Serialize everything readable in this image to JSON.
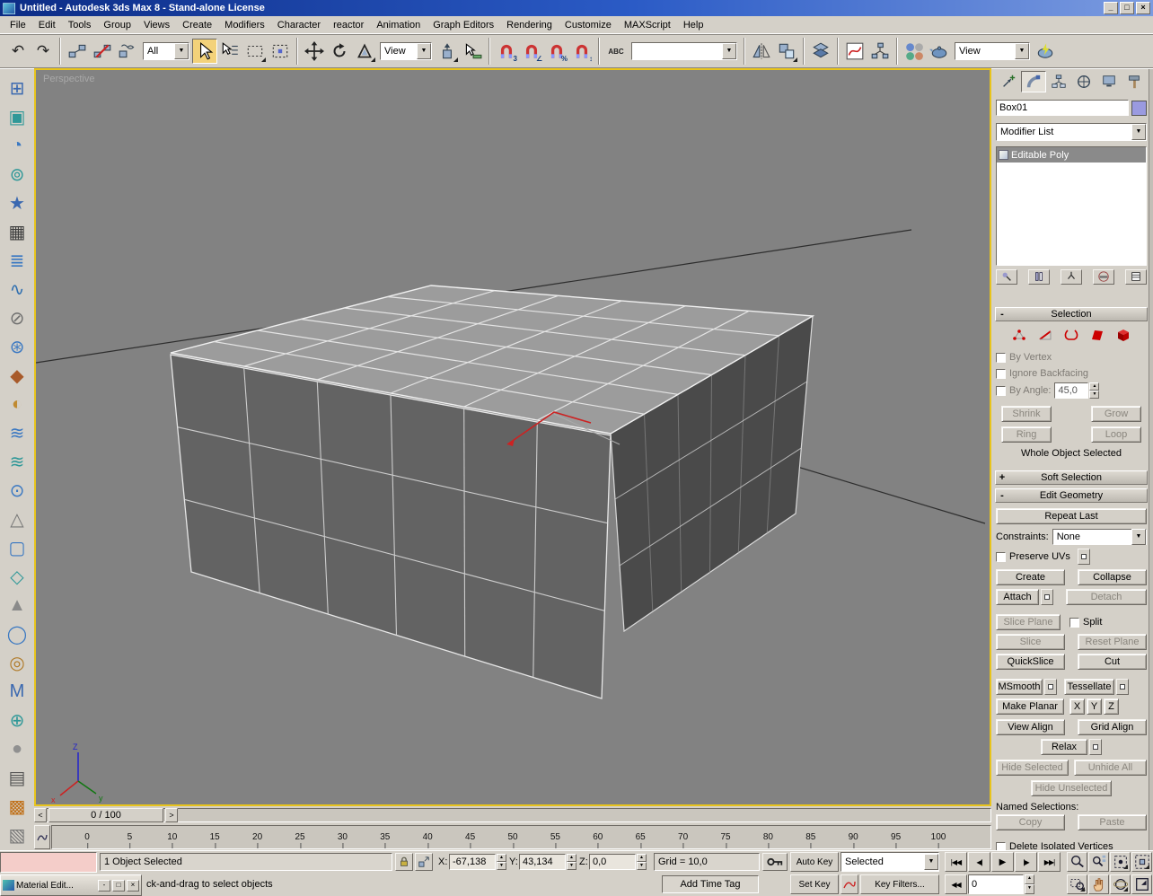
{
  "window": {
    "title": "Untitled - Autodesk 3ds Max 8 - Stand-alone License"
  },
  "menu": {
    "items": [
      "File",
      "Edit",
      "Tools",
      "Group",
      "Views",
      "Create",
      "Modifiers",
      "Character",
      "reactor",
      "Animation",
      "Graph Editors",
      "Rendering",
      "Customize",
      "MAXScript",
      "Help"
    ]
  },
  "toolbar": {
    "filter_value": "All",
    "coord_value": "View",
    "named_sets_value": "",
    "render_type_value": "View"
  },
  "left_toolbar": {
    "icons": [
      {
        "name": "left-tool-box-icon",
        "glyph": "⊞",
        "color": "#3a68b0"
      },
      {
        "name": "left-tool-cloth-icon",
        "glyph": "▣",
        "color": "#2f9898"
      },
      {
        "name": "left-tool-sphere-icon",
        "glyph": "◔",
        "color": "#3a78c2"
      },
      {
        "name": "left-tool-ring-icon",
        "glyph": "⊚",
        "color": "#2f9898"
      },
      {
        "name": "left-tool-star-icon",
        "glyph": "★",
        "color": "#3a68b0"
      },
      {
        "name": "left-tool-image-icon",
        "glyph": "▦",
        "color": "#3d3d3d"
      },
      {
        "name": "left-tool-stack-icon",
        "glyph": "≣",
        "color": "#3a78c2"
      },
      {
        "name": "left-tool-spline-icon",
        "glyph": "∿",
        "color": "#2f6fb0"
      },
      {
        "name": "left-tool-key-icon",
        "glyph": "⊘",
        "color": "#6f6f6f"
      },
      {
        "name": "left-tool-gear-icon",
        "glyph": "⊛",
        "color": "#3a78c2"
      },
      {
        "name": "left-tool-pick-icon",
        "glyph": "◆",
        "color": "#a85a2a"
      },
      {
        "name": "left-tool-hand-icon",
        "glyph": "◐",
        "color": "#c08a30"
      },
      {
        "name": "left-tool-wave-icon",
        "glyph": "≋",
        "color": "#3a78c2"
      },
      {
        "name": "left-tool-ripple-icon",
        "glyph": "≋",
        "color": "#2f9898"
      },
      {
        "name": "left-tool-lathe-icon",
        "glyph": "⊙",
        "color": "#3a78c2"
      },
      {
        "name": "left-tool-figure-icon",
        "glyph": "△",
        "color": "#777777"
      },
      {
        "name": "left-tool-cylinder-icon",
        "glyph": "▢",
        "color": "#3a78c2"
      },
      {
        "name": "left-tool-bone-icon",
        "glyph": "◇",
        "color": "#2f9898"
      },
      {
        "name": "left-tool-ik-icon",
        "glyph": "▲",
        "color": "#8a8a8a"
      },
      {
        "name": "left-tool-globe-icon",
        "glyph": "◯",
        "color": "#3a78c2"
      },
      {
        "name": "left-tool-spiral-icon",
        "glyph": "◎",
        "color": "#b07a28"
      },
      {
        "name": "left-tool-m-icon",
        "glyph": "M",
        "color": "#3a68b0"
      },
      {
        "name": "left-tool-circle-icon",
        "glyph": "⊕",
        "color": "#2f9898"
      },
      {
        "name": "left-tool-gray-sphere-icon",
        "glyph": "●",
        "color": "#909090"
      },
      {
        "name": "left-tool-list-icon",
        "glyph": "▤",
        "color": "#555555"
      },
      {
        "name": "left-tool-orange-box-icon",
        "glyph": "▩",
        "color": "#c07018"
      },
      {
        "name": "left-tool-hatch-icon",
        "glyph": "▧",
        "color": "#777777"
      }
    ]
  },
  "viewport": {
    "label": "Perspective"
  },
  "panel": {
    "object_name": "Box01",
    "object_color": "#9a9ae0",
    "modifier_list_label": "Modifier List",
    "stack_items": [
      {
        "label": "Editable Poly"
      }
    ],
    "selection": {
      "title": "Selection",
      "by_vertex": "By Vertex",
      "ignore_backfacing": "Ignore Backfacing",
      "by_angle": "By Angle:",
      "by_angle_value": "45,0",
      "shrink": "Shrink",
      "grow": "Grow",
      "ring": "Ring",
      "loop": "Loop",
      "status": "Whole Object Selected"
    },
    "soft_selection": {
      "title": "Soft Selection"
    },
    "edit_geometry": {
      "title": "Edit Geometry",
      "repeat_last": "Repeat Last",
      "constraints_label": "Constraints:",
      "constraints_value": "None",
      "preserve_uvs": "Preserve UVs",
      "create": "Create",
      "collapse": "Collapse",
      "attach": "Attach",
      "detach": "Detach",
      "slice_plane": "Slice Plane",
      "split": "Split",
      "slice": "Slice",
      "reset_plane": "Reset Plane",
      "quickslice": "QuickSlice",
      "cut": "Cut",
      "msmooth": "MSmooth",
      "tessellate": "Tessellate",
      "make_planar": "Make Planar",
      "x": "X",
      "y": "Y",
      "z": "Z",
      "view_align": "View Align",
      "grid_align": "Grid Align",
      "relax": "Relax",
      "hide_selected": "Hide Selected",
      "unhide_all": "Unhide All",
      "hide_unselected": "Hide Unselected",
      "named_selections": "Named Selections:",
      "copy": "Copy",
      "paste": "Paste",
      "delete_isolated": "Delete Isolated Vertices"
    }
  },
  "timeline": {
    "slider_label": "0 / 100",
    "ticks": [
      "0",
      "5",
      "10",
      "15",
      "20",
      "25",
      "30",
      "35",
      "40",
      "45",
      "50",
      "55",
      "60",
      "65",
      "70",
      "75",
      "80",
      "85",
      "90",
      "95",
      "100"
    ]
  },
  "status": {
    "selection_text": "1 Object Selected",
    "x_label": "X:",
    "x_value": "-67,138",
    "y_label": "Y:",
    "y_value": "43,134",
    "z_label": "Z:",
    "z_value": "0,0",
    "grid_text": "Grid = 10,0",
    "auto_key": "Auto Key",
    "set_key": "Set Key",
    "selected_set": "Selected",
    "key_filters": "Key Filters...",
    "add_time_tag": "Add Time Tag",
    "time_value": "0",
    "prompt": "ck-and-drag to select objects",
    "material_editor_title": "Material Edit..."
  }
}
